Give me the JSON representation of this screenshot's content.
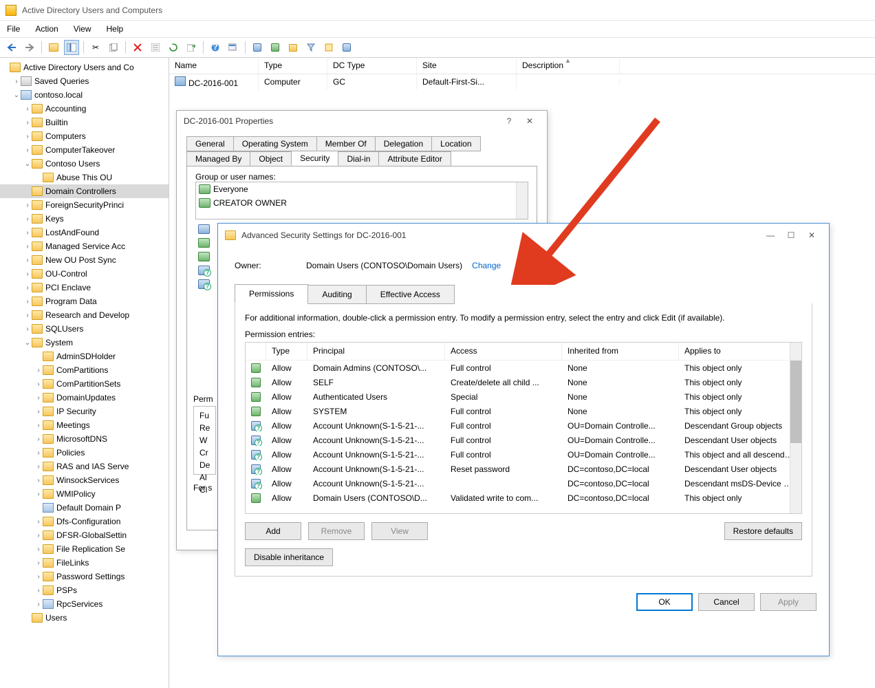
{
  "window": {
    "title": "Active Directory Users and Computers"
  },
  "menu": [
    "File",
    "Action",
    "View",
    "Help"
  ],
  "tree": {
    "root": "Active Directory Users and Co",
    "items": [
      {
        "d": 1,
        "exp": ">",
        "ic": "query",
        "t": "Saved Queries"
      },
      {
        "d": 1,
        "exp": "v",
        "ic": "domain",
        "t": "contoso.local"
      },
      {
        "d": 2,
        "exp": ">",
        "ic": "folder",
        "t": "Accounting"
      },
      {
        "d": 2,
        "exp": ">",
        "ic": "folder",
        "t": "Builtin"
      },
      {
        "d": 2,
        "exp": ">",
        "ic": "folder",
        "t": "Computers"
      },
      {
        "d": 2,
        "exp": ">",
        "ic": "folder",
        "t": "ComputerTakeover"
      },
      {
        "d": 2,
        "exp": "v",
        "ic": "folder",
        "t": "Contoso Users"
      },
      {
        "d": 3,
        "exp": " ",
        "ic": "folder",
        "t": "Abuse This OU"
      },
      {
        "d": 2,
        "exp": " ",
        "ic": "folder",
        "t": "Domain Controllers",
        "sel": true
      },
      {
        "d": 2,
        "exp": ">",
        "ic": "folder",
        "t": "ForeignSecurityPrinci"
      },
      {
        "d": 2,
        "exp": ">",
        "ic": "folder",
        "t": "Keys"
      },
      {
        "d": 2,
        "exp": ">",
        "ic": "folder",
        "t": "LostAndFound"
      },
      {
        "d": 2,
        "exp": ">",
        "ic": "folder",
        "t": "Managed Service Acc"
      },
      {
        "d": 2,
        "exp": ">",
        "ic": "folder",
        "t": "New OU Post Sync"
      },
      {
        "d": 2,
        "exp": ">",
        "ic": "folder",
        "t": "OU-Control"
      },
      {
        "d": 2,
        "exp": ">",
        "ic": "folder",
        "t": "PCI Enclave"
      },
      {
        "d": 2,
        "exp": ">",
        "ic": "folder",
        "t": "Program Data"
      },
      {
        "d": 2,
        "exp": ">",
        "ic": "folder",
        "t": "Research and Develop"
      },
      {
        "d": 2,
        "exp": ">",
        "ic": "folder",
        "t": "SQLUsers"
      },
      {
        "d": 2,
        "exp": "v",
        "ic": "folder",
        "t": "System"
      },
      {
        "d": 3,
        "exp": " ",
        "ic": "folder",
        "t": "AdminSDHolder"
      },
      {
        "d": 3,
        "exp": ">",
        "ic": "folder",
        "t": "ComPartitions"
      },
      {
        "d": 3,
        "exp": ">",
        "ic": "folder",
        "t": "ComPartitionSets"
      },
      {
        "d": 3,
        "exp": ">",
        "ic": "folder",
        "t": "DomainUpdates"
      },
      {
        "d": 3,
        "exp": ">",
        "ic": "folder",
        "t": "IP Security"
      },
      {
        "d": 3,
        "exp": ">",
        "ic": "folder",
        "t": "Meetings"
      },
      {
        "d": 3,
        "exp": ">",
        "ic": "folder",
        "t": "MicrosoftDNS"
      },
      {
        "d": 3,
        "exp": ">",
        "ic": "folder",
        "t": "Policies"
      },
      {
        "d": 3,
        "exp": ">",
        "ic": "folder",
        "t": "RAS and IAS Serve"
      },
      {
        "d": 3,
        "exp": ">",
        "ic": "folder",
        "t": "WinsockServices"
      },
      {
        "d": 3,
        "exp": ">",
        "ic": "folder",
        "t": "WMIPolicy"
      },
      {
        "d": 3,
        "exp": " ",
        "ic": "domain",
        "t": "Default Domain P"
      },
      {
        "d": 3,
        "exp": ">",
        "ic": "folder",
        "t": "Dfs-Configuration"
      },
      {
        "d": 3,
        "exp": ">",
        "ic": "folder",
        "t": "DFSR-GlobalSettin"
      },
      {
        "d": 3,
        "exp": ">",
        "ic": "folder",
        "t": "File Replication Se"
      },
      {
        "d": 3,
        "exp": ">",
        "ic": "folder",
        "t": "FileLinks"
      },
      {
        "d": 3,
        "exp": ">",
        "ic": "folder",
        "t": "Password Settings"
      },
      {
        "d": 3,
        "exp": ">",
        "ic": "folder",
        "t": "PSPs"
      },
      {
        "d": 3,
        "exp": ">",
        "ic": "domain",
        "t": "RpcServices"
      },
      {
        "d": 2,
        "exp": " ",
        "ic": "folder",
        "t": "Users"
      }
    ]
  },
  "list": {
    "cols": [
      "Name",
      "Type",
      "DC Type",
      "Site",
      "Description"
    ],
    "row": {
      "name": "DC-2016-001",
      "type": "Computer",
      "dc": "GC",
      "site": "Default-First-Si...",
      "desc": ""
    }
  },
  "props": {
    "title": "DC-2016-001 Properties",
    "tabs_row1": [
      "General",
      "Operating System",
      "Member Of",
      "Delegation",
      "Location"
    ],
    "tabs_row2": [
      "Managed By",
      "Object",
      "Security",
      "Dial-in",
      "Attribute Editor"
    ],
    "active_tab": "Security",
    "groups_label": "Group or user names:",
    "groups": [
      "Everyone",
      "CREATOR OWNER"
    ],
    "perm_label": "Perm",
    "perm_items": [
      "Fu",
      "Re",
      "W",
      "Cr",
      "De",
      "Al",
      "Cl"
    ],
    "forsel": "For s"
  },
  "adv": {
    "title": "Advanced Security Settings for DC-2016-001",
    "owner_label": "Owner:",
    "owner_value": "Domain Users (CONTOSO\\Domain Users)",
    "change": "Change",
    "tabs": [
      "Permissions",
      "Auditing",
      "Effective Access"
    ],
    "info": "For additional information, double-click a permission entry. To modify a permission entry, select the entry and click Edit (if available).",
    "entries_label": "Permission entries:",
    "cols": [
      "",
      "Type",
      "Principal",
      "Access",
      "Inherited from",
      "Applies to"
    ],
    "rows": [
      {
        "ic": "usr2",
        "type": "Allow",
        "prin": "Domain Admins (CONTOSO\\...",
        "acc": "Full control",
        "inh": "None",
        "app": "This object only"
      },
      {
        "ic": "usr2",
        "type": "Allow",
        "prin": "SELF",
        "acc": "Create/delete all child ...",
        "inh": "None",
        "app": "This object only"
      },
      {
        "ic": "usr2",
        "type": "Allow",
        "prin": "Authenticated Users",
        "acc": "Special",
        "inh": "None",
        "app": "This object only"
      },
      {
        "ic": "usr2",
        "type": "Allow",
        "prin": "SYSTEM",
        "acc": "Full control",
        "inh": "None",
        "app": "This object only"
      },
      {
        "ic": "usrq",
        "type": "Allow",
        "prin": "Account Unknown(S-1-5-21-...",
        "acc": "Full control",
        "inh": "OU=Domain Controlle...",
        "app": "Descendant Group objects"
      },
      {
        "ic": "usrq",
        "type": "Allow",
        "prin": "Account Unknown(S-1-5-21-...",
        "acc": "Full control",
        "inh": "OU=Domain Controlle...",
        "app": "Descendant User objects"
      },
      {
        "ic": "usrq",
        "type": "Allow",
        "prin": "Account Unknown(S-1-5-21-...",
        "acc": "Full control",
        "inh": "OU=Domain Controlle...",
        "app": "This object and all descendan..."
      },
      {
        "ic": "usrq",
        "type": "Allow",
        "prin": "Account Unknown(S-1-5-21-...",
        "acc": "Reset password",
        "inh": "DC=contoso,DC=local",
        "app": "Descendant User objects"
      },
      {
        "ic": "usrq",
        "type": "Allow",
        "prin": "Account Unknown(S-1-5-21-...",
        "acc": "",
        "inh": "DC=contoso,DC=local",
        "app": "Descendant msDS-Device obj..."
      },
      {
        "ic": "usr2",
        "type": "Allow",
        "prin": "Domain Users (CONTOSO\\D...",
        "acc": "Validated write to com...",
        "inh": "DC=contoso,DC=local",
        "app": "This object only"
      }
    ],
    "btns": {
      "add": "Add",
      "remove": "Remove",
      "view": "View",
      "restore": "Restore defaults",
      "disable": "Disable inheritance",
      "ok": "OK",
      "cancel": "Cancel",
      "apply": "Apply"
    }
  }
}
